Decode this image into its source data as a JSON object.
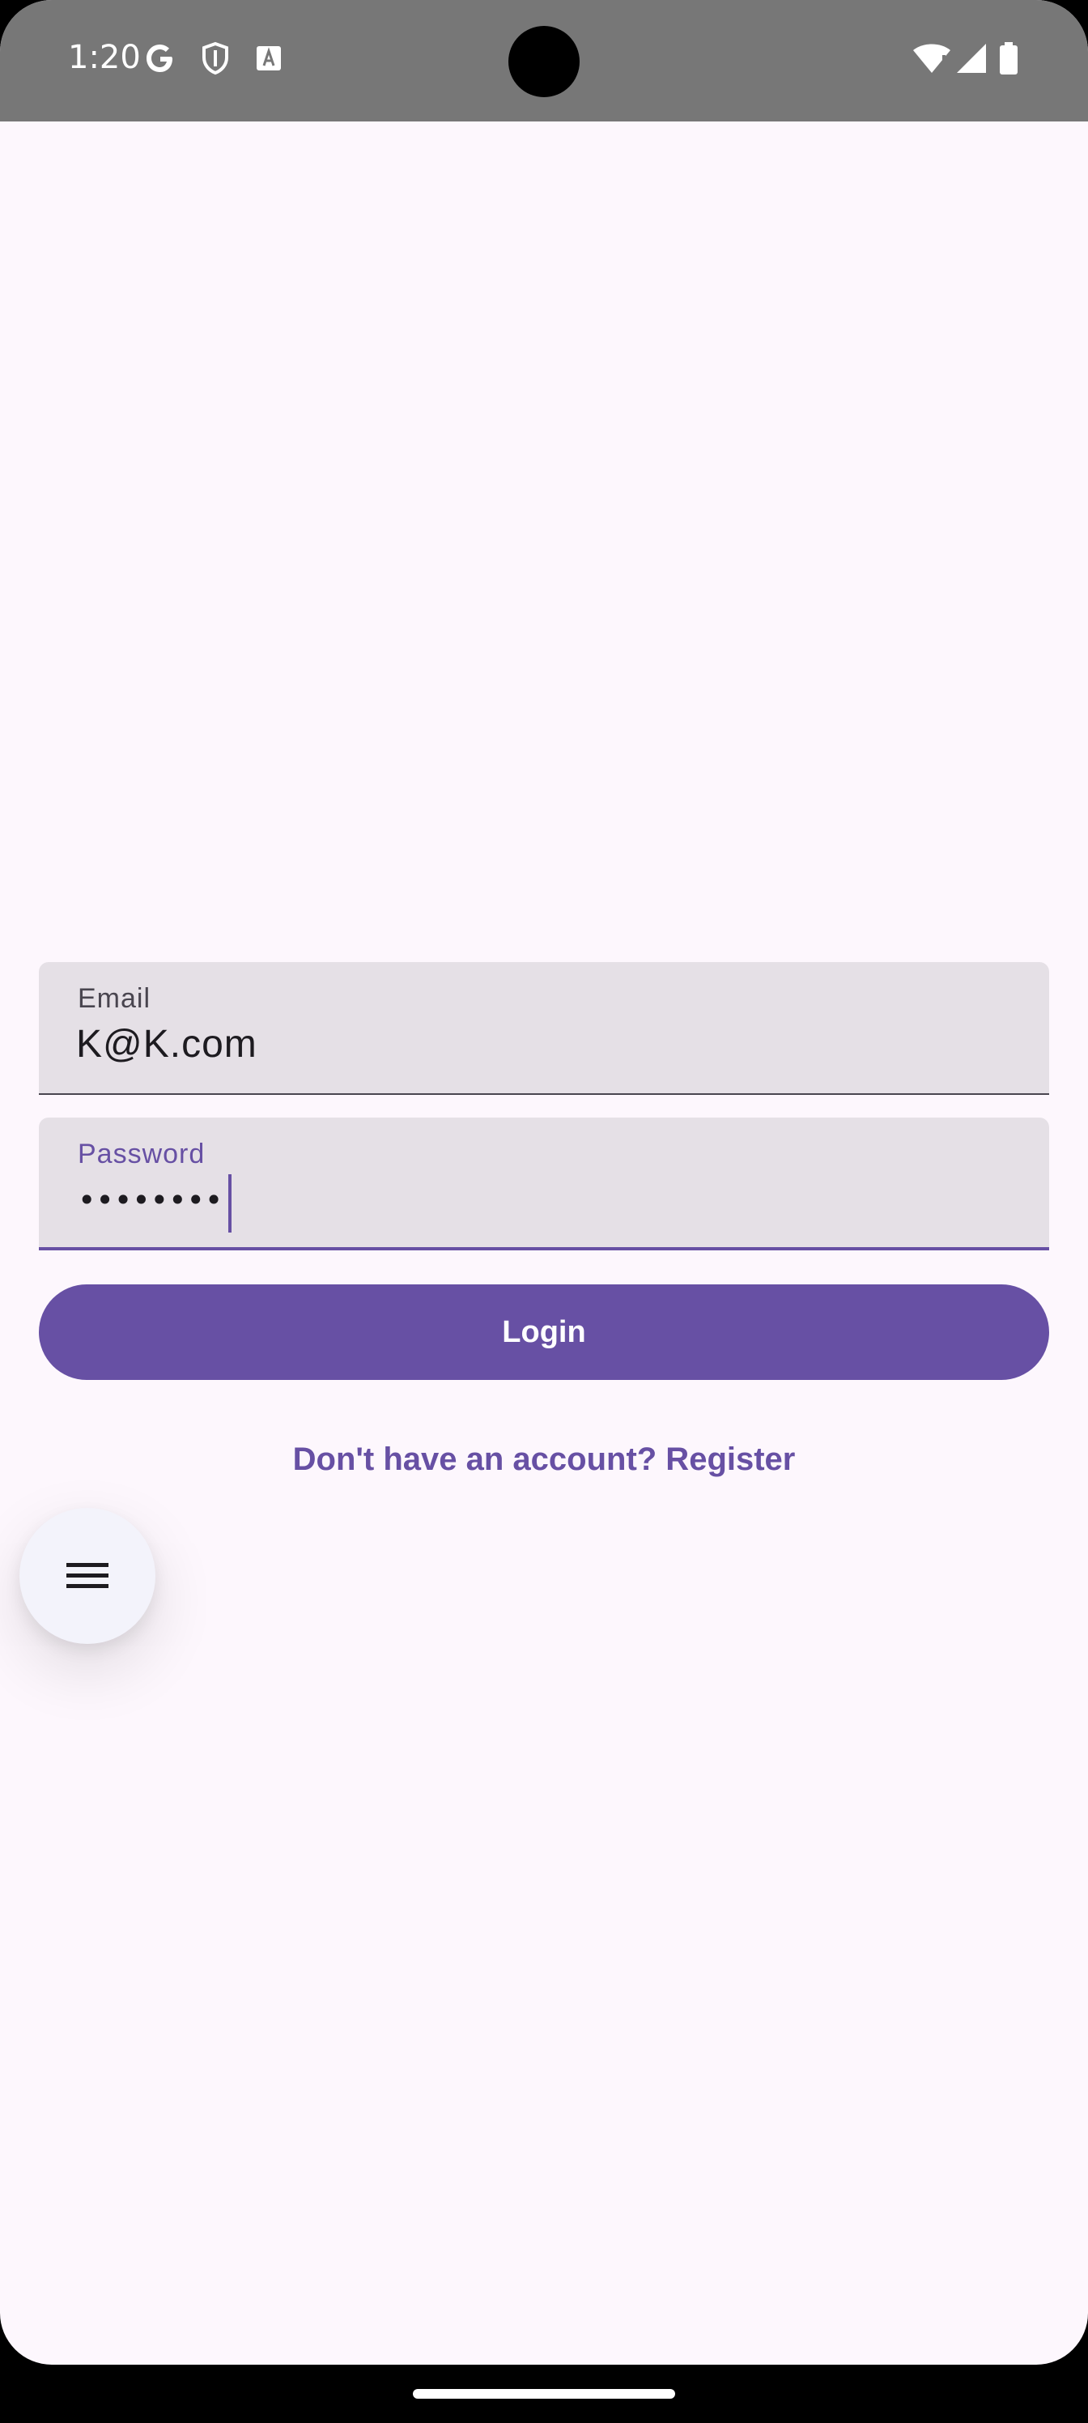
{
  "status_bar": {
    "time": "1:20",
    "icons_left": [
      "google-icon",
      "shield-icon",
      "font-icon"
    ],
    "icons_right": [
      "wifi-icon",
      "signal-icon",
      "battery-icon"
    ]
  },
  "login_form": {
    "email": {
      "label": "Email",
      "value": "K@K.com"
    },
    "password": {
      "label": "Password",
      "masked_value": "••••••••"
    },
    "login_button_label": "Login",
    "register_prompt": "Don't have an account? Register"
  },
  "fab": {
    "icon": "menu-icon"
  },
  "colors": {
    "primary": "#6750a4",
    "background": "#fdf7fd",
    "field_background": "#e5e0e6",
    "status_bar": "#777777"
  }
}
